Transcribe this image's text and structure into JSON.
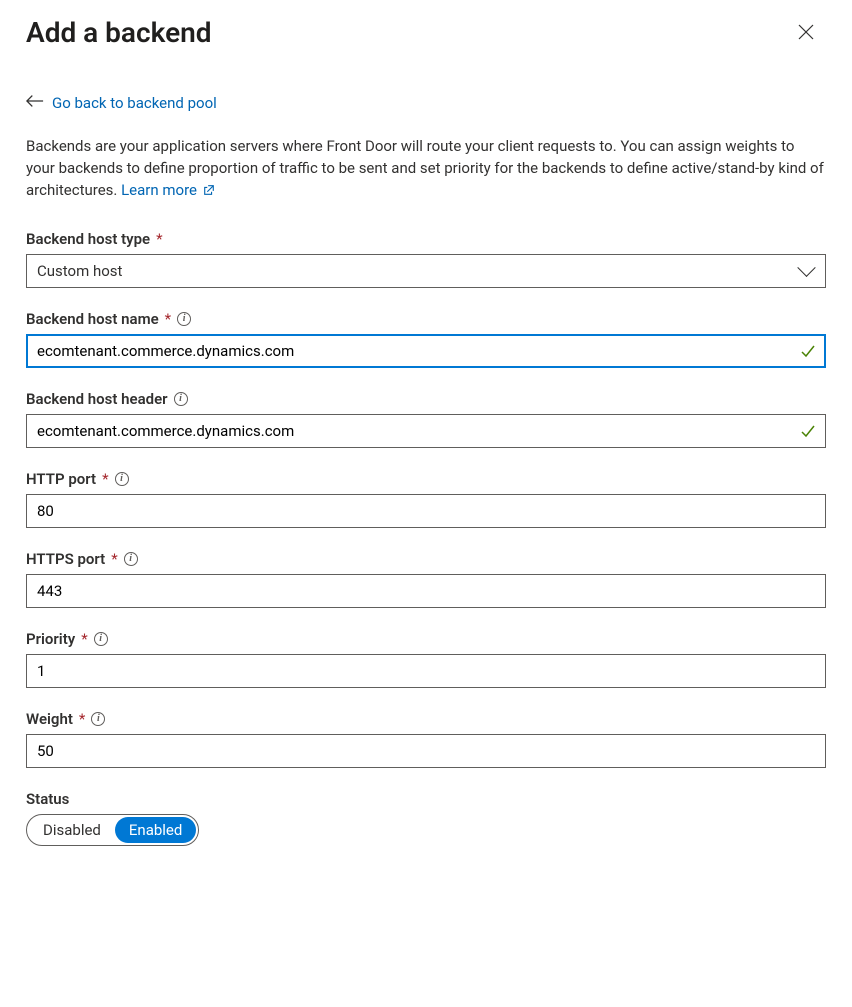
{
  "header": {
    "title": "Add a backend"
  },
  "back": {
    "label": "Go back to backend pool"
  },
  "description": {
    "text": "Backends are your application servers where Front Door will route your client requests to. You can assign weights to your backends to define proportion of traffic to be sent and set priority for the backends to define active/stand-by kind of architectures.",
    "learn_more": "Learn more"
  },
  "fields": {
    "host_type": {
      "label": "Backend host type",
      "value": "Custom host",
      "required": true
    },
    "host_name": {
      "label": "Backend host name",
      "value": "ecomtenant.commerce.dynamics.com",
      "required": true,
      "valid": true,
      "focused": true
    },
    "host_header": {
      "label": "Backend host header",
      "value": "ecomtenant.commerce.dynamics.com",
      "valid": true
    },
    "http_port": {
      "label": "HTTP port",
      "value": "80",
      "required": true
    },
    "https_port": {
      "label": "HTTPS port",
      "value": "443",
      "required": true
    },
    "priority": {
      "label": "Priority",
      "value": "1",
      "required": true
    },
    "weight": {
      "label": "Weight",
      "value": "50",
      "required": true
    },
    "status": {
      "label": "Status",
      "disabled_label": "Disabled",
      "enabled_label": "Enabled",
      "value": "Enabled"
    }
  }
}
